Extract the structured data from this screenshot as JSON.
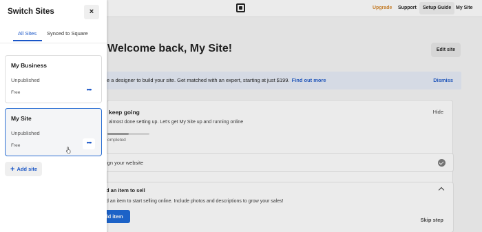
{
  "topbar": {
    "upgrade": "Upgrade",
    "support": "Support",
    "setup_guide": "Setup Guide",
    "my_site": "My Site"
  },
  "main": {
    "welcome": "Welcome back, My Site!",
    "edit_site": "Edit site",
    "banner": {
      "text": "e a designer to build your site. Get matched with an expert, starting at just $199.",
      "link": "Find out more",
      "dismiss": "Dismiss"
    },
    "setup_card": {
      "title": "keep going",
      "hide": "Hide",
      "subtitle": "almost done setting up. Let's get My Site up and running online",
      "progress": 0.5,
      "completed": "ompleted",
      "task1_label": "ign your website",
      "task2_title": "d an item to sell",
      "task2_desc": "d an item to start selling online. Include photos and descriptions to grow your sales!",
      "add_item": "dd item",
      "skip_step": "Skip step"
    }
  },
  "panel": {
    "title": "Switch Sites",
    "close": "×",
    "tabs": [
      {
        "label": "All Sites",
        "active": true
      },
      {
        "label": "Synced to Square",
        "active": false
      }
    ],
    "sites": [
      {
        "name": "My Business",
        "status": "Unpublished",
        "plan": "Free",
        "more": "•••",
        "selected": false
      },
      {
        "name": "My Site",
        "status": "Unpublished",
        "plan": "Free",
        "more": "•••",
        "selected": true
      }
    ],
    "add_site": "Add site",
    "add_icon": "+"
  },
  "colors": {
    "accent": "#1a56c7",
    "primary_button": "#1464d6",
    "upgrade": "#d4862a"
  }
}
